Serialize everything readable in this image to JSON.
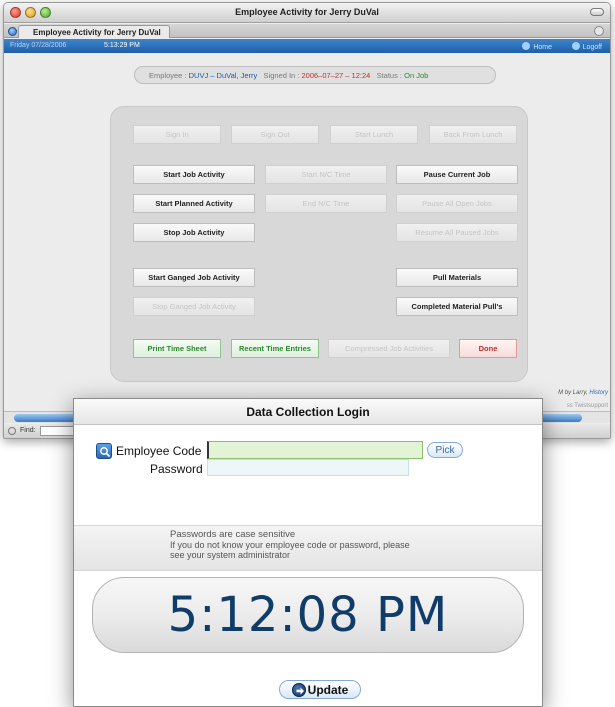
{
  "window": {
    "title": "Employee Activity for Jerry DuVal",
    "tab_label": "Employee Activity for Jerry DuVal"
  },
  "statusbar": {
    "date": "Friday 07/28/2006",
    "time": "5:13:29 PM",
    "home_label": "Home",
    "logoff_label": "Logoff"
  },
  "employee_bar": {
    "employee_label": "Employee :",
    "employee_value": "DUVJ – DuVal, Jerry",
    "signed_label": "Signed In :",
    "signed_value": "2006–07–27 – 12:24",
    "status_label": "Status :",
    "status_value": "On Job"
  },
  "actions": {
    "sign_in": "Sign In",
    "sign_out": "Sign Out",
    "start_lunch": "Start Lunch",
    "back_from_lunch": "Back From Lunch",
    "start_job_activity": "Start Job Activity",
    "start_nc_time": "Start N/C Time",
    "pause_current_job": "Pause Current Job",
    "start_planned_activity": "Start Planned Activity",
    "end_nc_time": "End N/C Time",
    "pause_all_open_jobs": "Pause All Open Jobs",
    "stop_job_activity": "Stop Job Activity",
    "resume_all_paused_jobs": "Resume All Paused Jobs",
    "start_ganged_job_activity": "Start Ganged Job Activity",
    "pull_materials": "Pull Materials",
    "stop_ganged_job_activity": "Stop Ganged Job Activity",
    "completed_material_pulls": "Completed Material Pull's",
    "print_time_sheet": "Print Time Sheet",
    "recent_time_entries": "Recent Time Entries",
    "compressed_job_activities": "Compressed Job Activities",
    "done": "Done"
  },
  "footer": {
    "credit": "M by Larry,",
    "credit_link": "History",
    "support": "ss Twistsupport",
    "find_label": "Find:"
  },
  "dialog": {
    "title": "Data Collection Login",
    "employee_code_label": "Employee Code",
    "employee_code_value": "",
    "pick_label": "Pick",
    "password_label": "Password",
    "password_value": "",
    "notice_title": "Passwords are case sensitive",
    "notice_line1": "If you do not know your employee code or password, please",
    "notice_line2": "see your system administrator",
    "clock": "5:12:08 PM",
    "update_label": "Update"
  },
  "colors": {
    "accent_blue": "#2a68b8",
    "status_green": "#2a8a2a",
    "alert_red": "#c0302a",
    "clock_text": "#0f3c68"
  }
}
